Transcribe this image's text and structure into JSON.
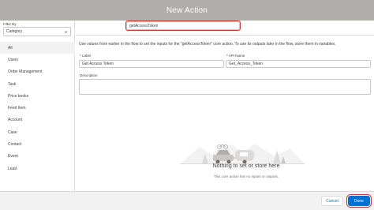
{
  "modal": {
    "title": "New Action"
  },
  "sidebar": {
    "filter_label": "Filter By",
    "filter_value": "Category",
    "items": [
      {
        "label": "All"
      },
      {
        "label": "Users"
      },
      {
        "label": "Order Management"
      },
      {
        "label": "Task"
      },
      {
        "label": "Price books"
      },
      {
        "label": "Feed Item"
      },
      {
        "label": "Account"
      },
      {
        "label": "Case"
      },
      {
        "label": "Contact"
      },
      {
        "label": "Event"
      },
      {
        "label": "Lead"
      }
    ]
  },
  "search": {
    "value": "getAccessToken"
  },
  "main": {
    "description": "Use values from earlier in the flow to set the inputs for the \"getAccessToken\" core action. To use its outputs later in the flow, store them in variables.",
    "label_field": {
      "label": "* Label",
      "value": "Get Access Token"
    },
    "api_field": {
      "label": "* API Name",
      "value": "Get_Access_Token"
    },
    "description_field": {
      "label": "Description",
      "value": ""
    },
    "empty_state": {
      "title": "Nothing to set or store here",
      "subtitle": "This core action has no inputs or outputs."
    }
  },
  "footer": {
    "cancel_label": "Cancel",
    "done_label": "Done"
  },
  "colors": {
    "brand": "#0070d2",
    "highlight": "#c23934",
    "header_bg": "#b0adab"
  }
}
